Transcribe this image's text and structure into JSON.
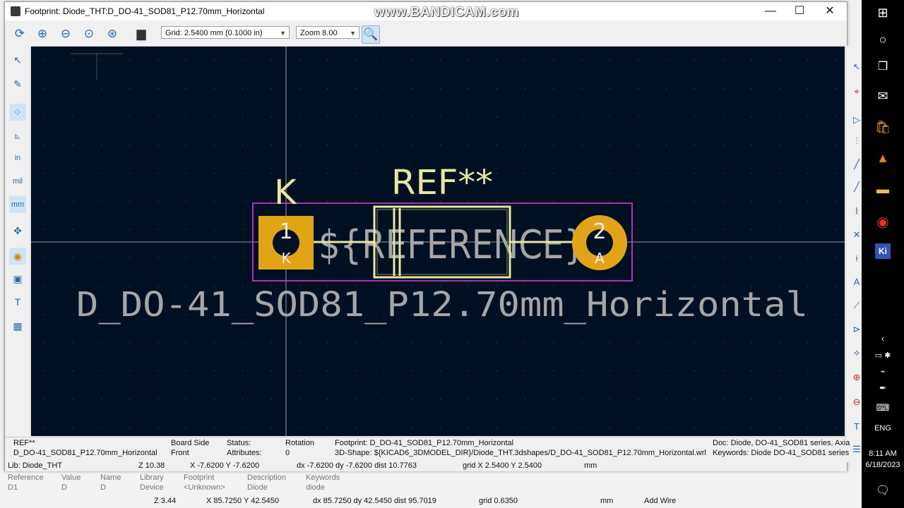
{
  "window": {
    "title": "Footprint: Diode_THT:D_DO-41_SOD81_P12.70mm_Horizontal",
    "watermark": "www.BANDICAM.com",
    "minimize": "—",
    "maximize": "☐",
    "close": "✕"
  },
  "toolbar": {
    "grid_select": "Grid: 2.5400 mm (0.1000 in)",
    "zoom_select": "Zoom 8.00"
  },
  "left_toolbar": {
    "in_label": "in",
    "mil_label": "mil",
    "mm_label": "mm"
  },
  "footprint": {
    "ref_text": "REF**",
    "k_label": "K",
    "pad1_number": "1",
    "pad1_name": "K",
    "pad2_number": "2",
    "pad2_name": "A",
    "reference_field": "${REFERENCE}",
    "value_text": "D_DO-41_SOD81_P12.70mm_Horizontal"
  },
  "status": {
    "ref_label": "REF**",
    "ref_value": "D_DO-41_SOD81_P12.70mm_Horizontal",
    "board_side_label": "Board Side",
    "board_side_value": "Front",
    "status_label": "Status:",
    "attributes_label": "Attributes:",
    "rotation_label": "Rotation",
    "rotation_value": "0",
    "footprint_line": "Footprint: D_DO-41_SOD81_P12.70mm_Horizontal",
    "shape_line": "3D-Shape: ${KICAD6_3DMODEL_DIR}/Diode_THT.3dshapes/D_DO-41_SOD81_P12.70mm_Horizontal.wrl",
    "doc_line": "Doc: Diode, DO-41_SOD81 series, Axia",
    "keywords_line": "Keywords: Diode DO-41_SOD81 series",
    "lib": "Lib: Diode_THT",
    "z": "Z 10.38",
    "xy": "X -7.6200  Y -7.6200",
    "dxdy": "dx -7.6200  dy -7.6200  dist 10.7763",
    "grid": "grid X 2.5400  Y 2.5400",
    "units": "mm"
  },
  "background_panel": {
    "reference_label": "Reference",
    "reference_value": "D1",
    "value_label": "Value",
    "value_value": "D",
    "name_label": "Name",
    "name_value": "D",
    "library_label": "Library",
    "library_value": "Device",
    "footprint_label": "Footprint",
    "footprint_value": "<Unknown>",
    "description_label": "Description",
    "description_value": "Diode",
    "keywords_label": "Keywords",
    "keywords_value": "diode",
    "z": "Z 3.44",
    "xy": "X 85.7250  Y 42.5450",
    "dxdy": "dx 85.7250  dy 42.5450  dist 95.7019",
    "grid": "grid 0.6350",
    "units": "mm",
    "mode": "Add Wire"
  },
  "taskbar": {
    "time": "8:11 AM",
    "date": "6/18/2023",
    "lang": "ENG"
  }
}
